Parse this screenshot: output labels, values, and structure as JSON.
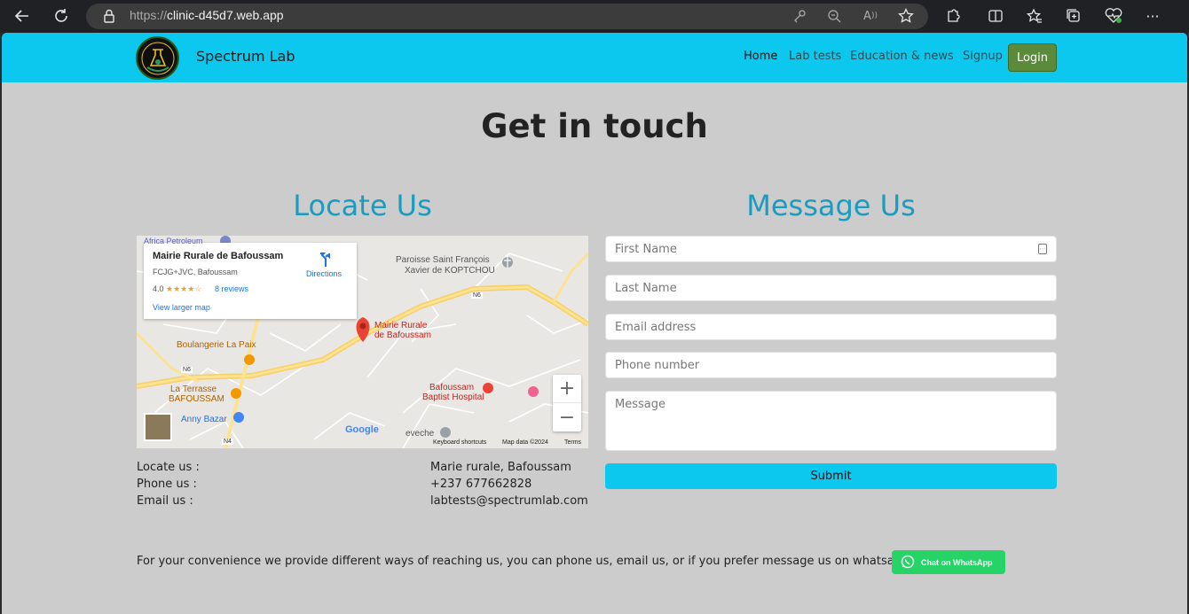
{
  "browser": {
    "url_protocol": "https://",
    "url_host": "clinic-d45d7.web.app"
  },
  "navbar": {
    "brand": "Spectrum Lab",
    "links": [
      "Home",
      "Lab tests",
      "Education & news",
      "Signup"
    ],
    "login_label": "Login"
  },
  "page": {
    "title": "Get in touch",
    "locate_title": "Locate Us",
    "message_title": "Message Us"
  },
  "map": {
    "place_name": "Mairie Rurale de Bafoussam",
    "address": "FCJG+JVC, Bafoussam",
    "rating": "4.0",
    "stars": "★★★★☆",
    "reviews": "8 reviews",
    "directions": "Directions",
    "view_larger": "View larger map",
    "labels": {
      "africa": "Africa Petroleum",
      "paroisse_1": "Paroisse Saint François",
      "paroisse_2": "Xavier de KOPTCHOU",
      "pin_1": "Mairie Rurale",
      "pin_2": "de Bafoussam",
      "boulangerie": "Boulangerie La Paix",
      "terrasse_1": "La Terrasse",
      "terrasse_2": "BAFOUSSAM",
      "anny": "Anny Bazar",
      "hospital_1": "Bafoussam",
      "hospital_2": "Baptist Hospital",
      "eveche": "eveche",
      "n6_a": "N6",
      "n6_b": "N6",
      "n4": "N4"
    },
    "google": "Google",
    "keyboard": "Keyboard shortcuts",
    "mapdata": "Map data ©2024",
    "terms": "Terms"
  },
  "contact": {
    "locate_label": "Locate us :",
    "phone_label": "Phone us :",
    "email_label": "Email us :",
    "locate_value": "Marie rurale, Bafoussam",
    "phone_value": "+237 677662828",
    "email_value": "labtests@spectrumlab.com"
  },
  "form": {
    "first_name": "First Name",
    "last_name": "Last Name",
    "email": "Email address",
    "phone": "Phone number",
    "message": "Message",
    "submit": "Submit"
  },
  "footer": {
    "text": "For your convenience we provide different ways of reaching us, you can phone us, email us, or if you prefer message us on whatsapp",
    "whatsapp": "Chat on WhatsApp"
  },
  "colors": {
    "accent": "#0dc8ee",
    "title_blue": "#1a9bc0",
    "login_green": "#5a8a3a",
    "whatsapp_green": "#25d366"
  }
}
